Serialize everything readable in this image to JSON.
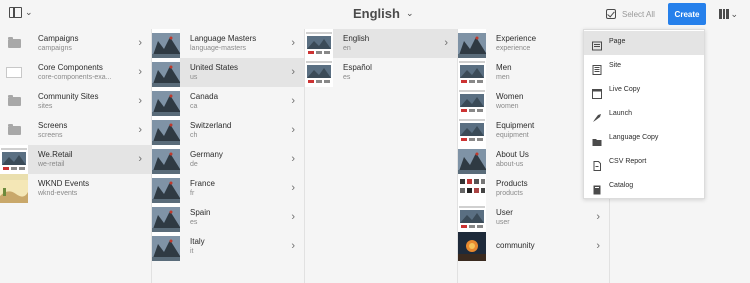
{
  "toolbar": {
    "title": "English",
    "select_all_label": "Select All",
    "create_label": "Create"
  },
  "columns": [
    {
      "items": [
        {
          "title": "Campaigns",
          "name": "campaigns",
          "thumb": "folder",
          "has_children": true,
          "selected": false
        },
        {
          "title": "Core Components",
          "name": "core-components-exa...",
          "thumb": "empty",
          "has_children": true,
          "selected": false
        },
        {
          "title": "Community Sites",
          "name": "sites",
          "thumb": "folder",
          "has_children": true,
          "selected": false
        },
        {
          "title": "Screens",
          "name": "screens",
          "thumb": "folder",
          "has_children": true,
          "selected": false
        },
        {
          "title": "We.Retail",
          "name": "we-retail",
          "thumb": "site",
          "has_children": true,
          "selected": true
        },
        {
          "title": "WKND Events",
          "name": "wknd-events",
          "thumb": "desert",
          "has_children": false,
          "selected": false
        }
      ]
    },
    {
      "items": [
        {
          "title": "Language Masters",
          "name": "language-masters",
          "thumb": "climber",
          "has_children": true,
          "selected": false
        },
        {
          "title": "United States",
          "name": "us",
          "thumb": "climber",
          "has_children": true,
          "selected": true
        },
        {
          "title": "Canada",
          "name": "ca",
          "thumb": "climber",
          "has_children": true,
          "selected": false
        },
        {
          "title": "Switzerland",
          "name": "ch",
          "thumb": "climber",
          "has_children": true,
          "selected": false
        },
        {
          "title": "Germany",
          "name": "de",
          "thumb": "climber",
          "has_children": true,
          "selected": false
        },
        {
          "title": "France",
          "name": "fr",
          "thumb": "climber",
          "has_children": true,
          "selected": false
        },
        {
          "title": "Spain",
          "name": "es",
          "thumb": "climber",
          "has_children": true,
          "selected": false
        },
        {
          "title": "Italy",
          "name": "it",
          "thumb": "climber",
          "has_children": true,
          "selected": false
        }
      ]
    },
    {
      "items": [
        {
          "title": "English",
          "name": "en",
          "thumb": "site",
          "has_children": true,
          "selected": true
        },
        {
          "title": "Español",
          "name": "es",
          "thumb": "site",
          "has_children": false,
          "selected": false
        }
      ]
    },
    {
      "items": [
        {
          "title": "Experience",
          "name": "experience",
          "thumb": "climber",
          "has_children": true,
          "selected": false
        },
        {
          "title": "Men",
          "name": "men",
          "thumb": "site",
          "has_children": true,
          "selected": false
        },
        {
          "title": "Women",
          "name": "women",
          "thumb": "site",
          "has_children": true,
          "selected": false
        },
        {
          "title": "Equipment",
          "name": "equipment",
          "thumb": "site",
          "has_children": true,
          "selected": false
        },
        {
          "title": "About Us",
          "name": "about-us",
          "thumb": "climber",
          "has_children": true,
          "selected": false
        },
        {
          "title": "Products",
          "name": "products",
          "thumb": "products",
          "has_children": true,
          "selected": false
        },
        {
          "title": "User",
          "name": "user",
          "thumb": "site",
          "has_children": true,
          "selected": false
        },
        {
          "title": "community",
          "name": "",
          "thumb": "camp",
          "has_children": true,
          "selected": false
        }
      ]
    }
  ],
  "create_menu": {
    "items": [
      {
        "label": "Page",
        "icon": "page-icon",
        "highlighted": true
      },
      {
        "label": "Site",
        "icon": "site-icon",
        "highlighted": false
      },
      {
        "label": "Live Copy",
        "icon": "live-copy-icon",
        "highlighted": false
      },
      {
        "label": "Launch",
        "icon": "launch-icon",
        "highlighted": false
      },
      {
        "label": "Language Copy",
        "icon": "language-copy-icon",
        "highlighted": false
      },
      {
        "label": "CSV Report",
        "icon": "csv-report-icon",
        "highlighted": false
      },
      {
        "label": "Catalog",
        "icon": "catalog-icon",
        "highlighted": false
      }
    ]
  },
  "colors": {
    "accent": "#2680eb",
    "selected_row": "#e4e4e4",
    "background": "#f5f5f5"
  }
}
